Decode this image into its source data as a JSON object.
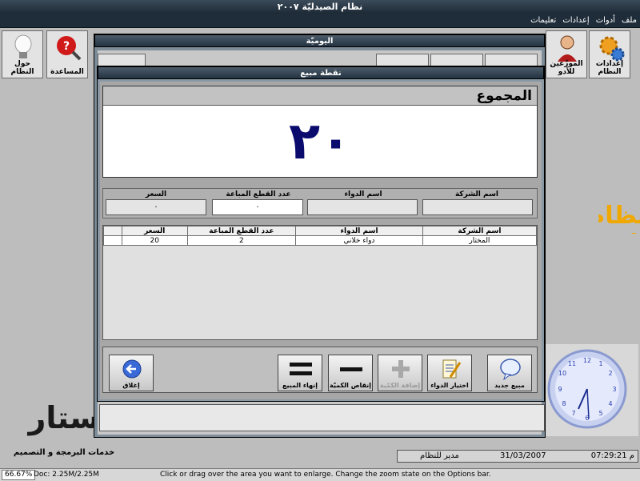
{
  "app": {
    "title": "نظام الصيدليّة ٢٠٠٧"
  },
  "menu": {
    "items": [
      "ملف",
      "أدوات",
      "إعدادات",
      "تعليمات"
    ]
  },
  "toolbar": {
    "left": [
      {
        "label": "حول النظام",
        "icon": "lightbulb-icon"
      },
      {
        "label": "المساعدة",
        "icon": "help-search-icon"
      }
    ],
    "right": [
      {
        "label": "إعدادات النظام",
        "icon": "gears-icon"
      },
      {
        "label": "الموزّعين للأدو",
        "icon": "person-icon"
      }
    ]
  },
  "daily_window": {
    "title": "اليوميّة"
  },
  "sale_window": {
    "title": "نقطة مبيع",
    "total": {
      "label": "المجموع",
      "value": "٢٠"
    },
    "fields": {
      "company_label": "اسم الشركة",
      "drug_label": "اسم الدواء",
      "qty_label": "عدد القطع المباعة",
      "price_label": "السعر",
      "company_value": "",
      "drug_value": "",
      "qty_value": "٠",
      "price_value": "٠"
    },
    "table": {
      "headers": [
        "اسم الشركة",
        "اسم الدواء",
        "عدد القطع المباعة",
        "السعر"
      ],
      "rows": [
        [
          "المختار",
          "دواء خلاني",
          "2",
          "20"
        ]
      ]
    },
    "buttons": {
      "new_sale": "مبيع جديد",
      "choose_drug": "اختيار الدواء",
      "add_qty": "إضافة الكمّية",
      "decrease_qty": "إنقاص الكميّة",
      "end_sale": "إنهاء المبيع",
      "close": "إغلاق"
    }
  },
  "background": {
    "banner_text": "نظام ال",
    "logo_text": "ستار",
    "logo_sub": "خدمات البرمجة و التصميم"
  },
  "bottom_info": {
    "time": "07:29:21 م",
    "date": "31/03/2007",
    "user": "مدير للنظام"
  },
  "statusbar": {
    "zoom": "66.67%",
    "doc": "Doc: 2.25M/2.25M",
    "hint": "Click or drag over the area you want to enlarge. Change the zoom state on the Options bar."
  },
  "colors": {
    "titlebar": "#233240",
    "total_number": "#0b0b6e",
    "panel": "#a7a7a7"
  }
}
